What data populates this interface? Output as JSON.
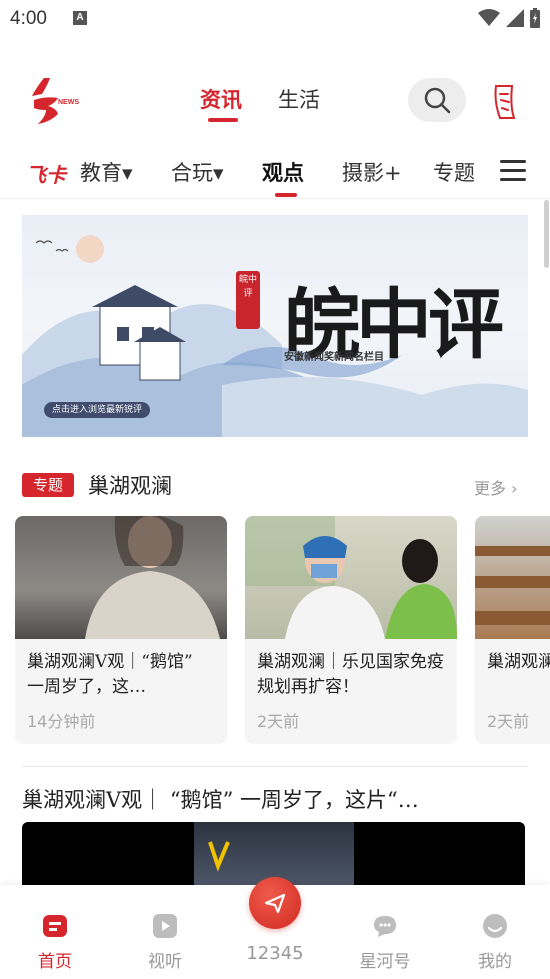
{
  "status_bar": {
    "time": "4:00",
    "notif_icon": "A"
  },
  "header": {
    "tabs": [
      {
        "label": "资讯",
        "active": true
      },
      {
        "label": "生活",
        "active": false
      }
    ]
  },
  "channels": {
    "feika": "飞卡",
    "items": [
      {
        "label": "教育▾"
      },
      {
        "label": "合玩▾"
      },
      {
        "label": "观点",
        "active": true
      },
      {
        "label": "摄影+"
      },
      {
        "label": "专题"
      }
    ]
  },
  "banner": {
    "title": "皖中评",
    "seal": "皖中评",
    "subtitle": "安徽新闻奖新闻名栏目",
    "cta": "点击进入浏览最新锐评"
  },
  "special": {
    "badge": "专题",
    "title": "巢湖观澜",
    "more": "更多 ›",
    "cards": [
      {
        "title": "巢湖观澜V观｜“鹅馆” 一周岁了，这…",
        "time": "14分钟前"
      },
      {
        "title": "巢湖观澜｜乐见国家免疫规划再扩容！",
        "time": "2天前"
      },
      {
        "title": "巢湖观澜｜捐赠回馈…",
        "time": "2天前"
      }
    ]
  },
  "article": {
    "title": "巢湖观澜V观｜ “鹅馆” 一周岁了，这片“…"
  },
  "bottom_nav": {
    "items": [
      {
        "label": "首页",
        "active": true
      },
      {
        "label": "视听"
      },
      {
        "label": "12345"
      },
      {
        "label": "星河号"
      },
      {
        "label": "我的"
      }
    ]
  },
  "colors": {
    "accent": "#d6262d"
  }
}
